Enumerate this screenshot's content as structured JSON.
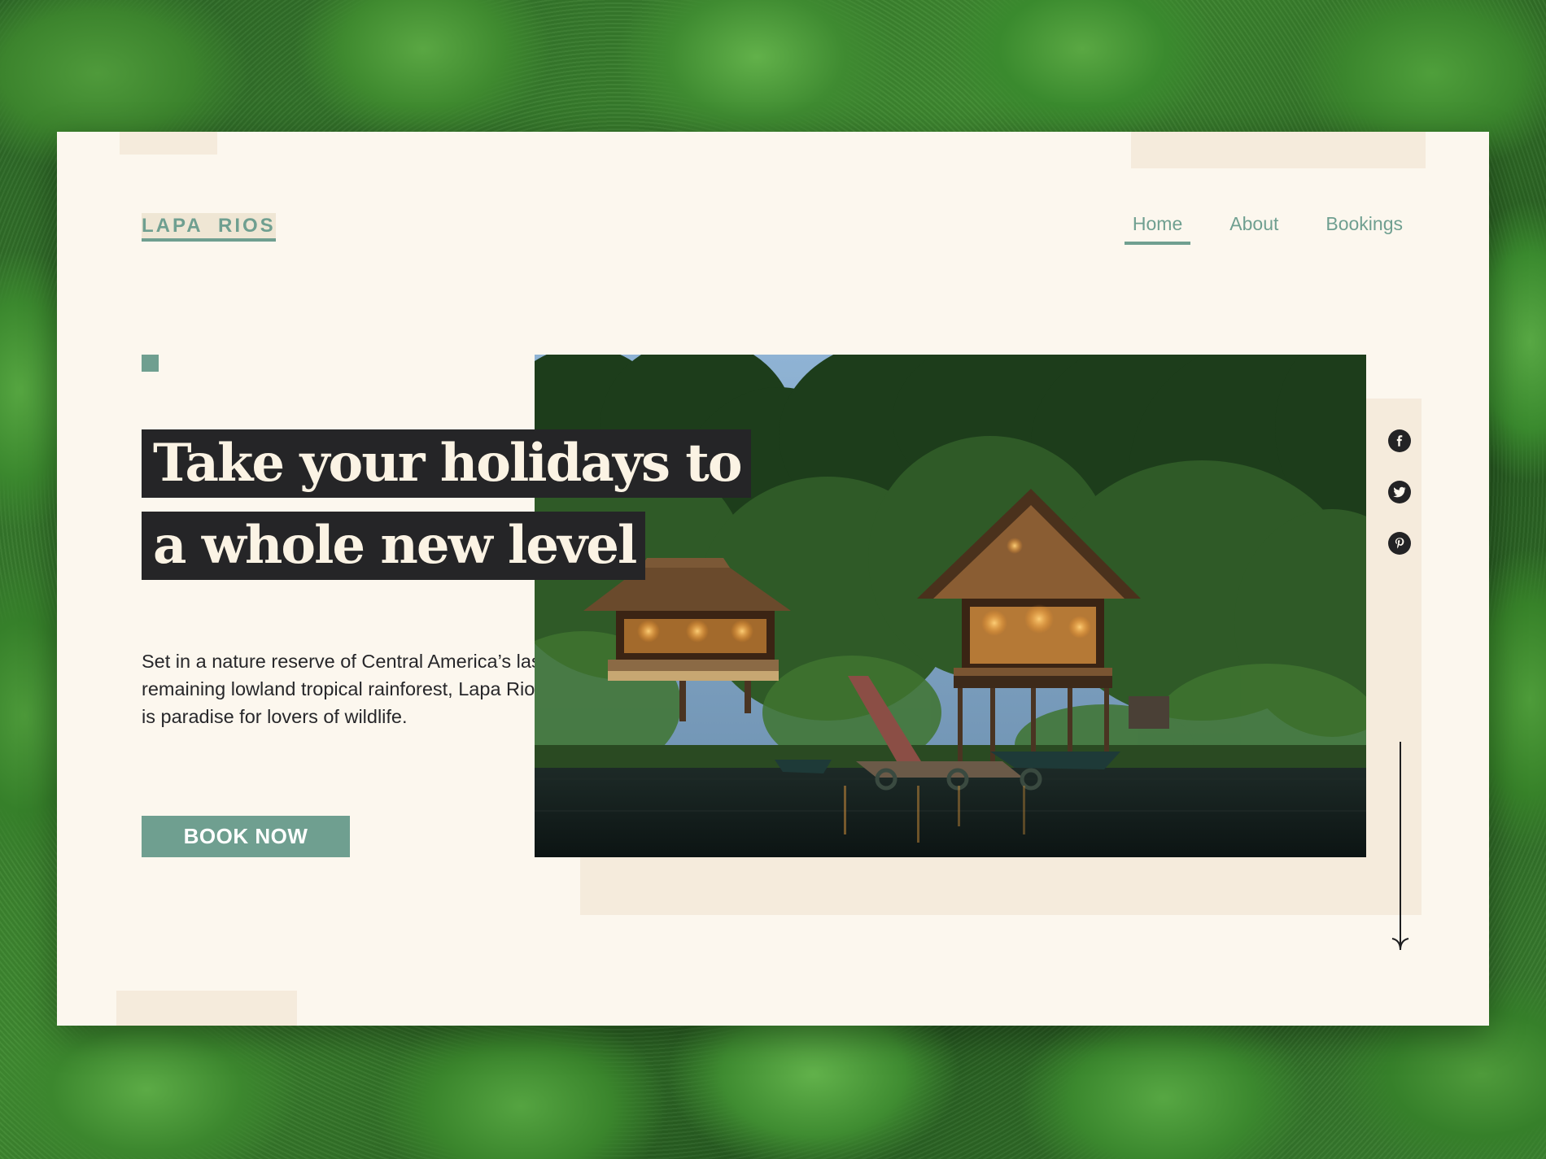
{
  "brand": {
    "logo": "LAPA  RIOS"
  },
  "nav": {
    "items": [
      {
        "label": "Home",
        "active": true
      },
      {
        "label": "About",
        "active": false
      },
      {
        "label": "Bookings",
        "active": false
      }
    ]
  },
  "hero": {
    "headline_line1": "Take your holidays to",
    "headline_line2": "a whole new level",
    "description": "Set in a nature reserve of Central America’s last remaining lowland tropical rainforest, Lapa Rios is paradise for lovers of wildlife.",
    "cta_label": "BOOK NOW",
    "image": "lodge-photo"
  },
  "social": [
    {
      "icon": "facebook-icon",
      "glyph": "f"
    },
    {
      "icon": "twitter-icon",
      "glyph": "t"
    },
    {
      "icon": "pinterest-icon",
      "glyph": "p"
    }
  ],
  "scroll_icon": "arrow-down-icon",
  "colors": {
    "accent": "#6f9f90",
    "card_background": "#fcf7ee",
    "decor_beige": "#f5ebdc",
    "headline_background": "#252527",
    "headline_text": "#fbf3e4",
    "body_text": "#27272a"
  }
}
